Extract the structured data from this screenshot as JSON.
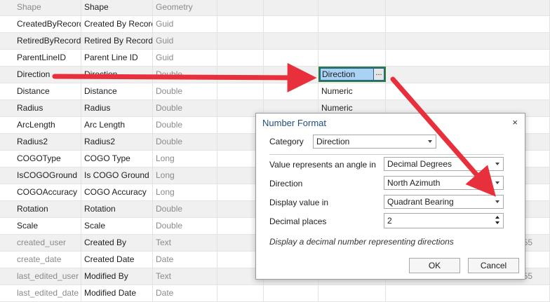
{
  "rows": [
    {
      "field": "Shape",
      "alias": "Shape",
      "type": "Geometry",
      "domain": "",
      "len": "",
      "alt": true,
      "gray": true
    },
    {
      "field": "CreatedByRecord",
      "alias": "Created By Record",
      "type": "Guid",
      "domain": "",
      "len": "",
      "alt": false,
      "gray": false
    },
    {
      "field": "RetiredByRecord",
      "alias": "Retired By Record",
      "type": "Guid",
      "domain": "",
      "len": "",
      "alt": true,
      "gray": false
    },
    {
      "field": "ParentLineID",
      "alias": "Parent Line ID",
      "type": "Guid",
      "domain": "",
      "len": "",
      "alt": false,
      "gray": false
    },
    {
      "field": "Direction",
      "alias": "Direction",
      "type": "Double",
      "domain": "Direction",
      "len": "",
      "alt": true,
      "gray": false
    },
    {
      "field": "Distance",
      "alias": "Distance",
      "type": "Double",
      "domain": "Numeric",
      "len": "",
      "alt": false,
      "gray": false
    },
    {
      "field": "Radius",
      "alias": "Radius",
      "type": "Double",
      "domain": "Numeric",
      "len": "",
      "alt": true,
      "gray": false
    },
    {
      "field": "ArcLength",
      "alias": "Arc Length",
      "type": "Double",
      "domain": "",
      "len": "",
      "alt": false,
      "gray": false
    },
    {
      "field": "Radius2",
      "alias": "Radius2",
      "type": "Double",
      "domain": "",
      "len": "",
      "alt": true,
      "gray": false
    },
    {
      "field": "COGOType",
      "alias": "COGO Type",
      "type": "Long",
      "domain": "",
      "len": "",
      "alt": false,
      "gray": false
    },
    {
      "field": "IsCOGOGround",
      "alias": "Is COGO Ground",
      "type": "Long",
      "domain": "",
      "len": "",
      "alt": true,
      "gray": false
    },
    {
      "field": "COGOAccuracy",
      "alias": "COGO Accuracy",
      "type": "Long",
      "domain": "",
      "len": "",
      "alt": false,
      "gray": false
    },
    {
      "field": "Rotation",
      "alias": "Rotation",
      "type": "Double",
      "domain": "",
      "len": "",
      "alt": true,
      "gray": false
    },
    {
      "field": "Scale",
      "alias": "Scale",
      "type": "Double",
      "domain": "",
      "len": "",
      "alt": false,
      "gray": false
    },
    {
      "field": "created_user",
      "alias": "Created By",
      "type": "Text",
      "domain": "",
      "len": "255",
      "alt": true,
      "gray": true
    },
    {
      "field": "create_date",
      "alias": "Created Date",
      "type": "Date",
      "domain": "",
      "len": "",
      "alt": false,
      "gray": true
    },
    {
      "field": "last_edited_user",
      "alias": "Modified By",
      "type": "Text",
      "domain": "",
      "len": "255",
      "alt": true,
      "gray": true
    },
    {
      "field": "last_edited_date",
      "alias": "Modified Date",
      "type": "Date",
      "domain": "",
      "len": "",
      "alt": false,
      "gray": true
    }
  ],
  "domain_button": "...",
  "dialog": {
    "title": "Number Format",
    "close": "×",
    "category_label": "Category",
    "category_value": "Direction",
    "angle_label": "Value represents an angle in",
    "angle_value": "Decimal Degrees",
    "direction_label": "Direction",
    "direction_value": "North Azimuth",
    "display_label": "Display value in",
    "display_value": "Quadrant Bearing",
    "decimal_label": "Decimal places",
    "decimal_value": "2",
    "hint": "Display a decimal number representing directions",
    "ok": "OK",
    "cancel": "Cancel"
  },
  "colors": {
    "arrow": "#e8303d",
    "selection": "#a9d2f3",
    "highlight_border": "#2f7c3d",
    "title": "#1f4e79"
  }
}
